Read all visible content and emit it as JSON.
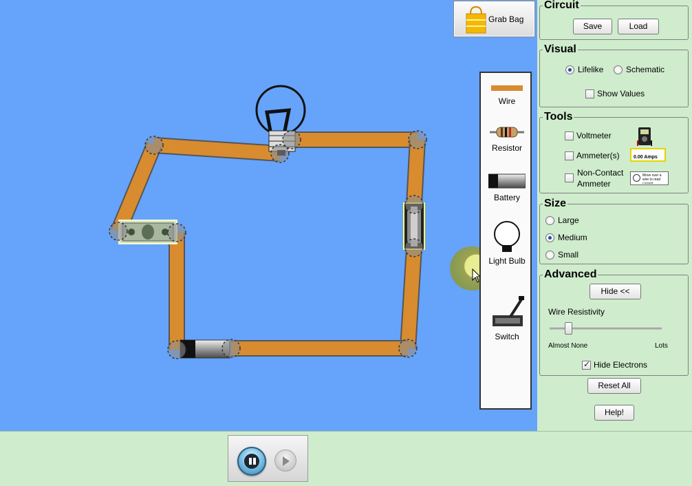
{
  "grab_bag": {
    "label": "Grab Bag"
  },
  "toolbox": {
    "items": [
      {
        "label": "Wire",
        "icon": "wire-icon"
      },
      {
        "label": "Resistor",
        "icon": "resistor-icon"
      },
      {
        "label": "Battery",
        "icon": "battery-icon"
      },
      {
        "label": "Light Bulb",
        "icon": "light-bulb-icon"
      },
      {
        "label": "Switch",
        "icon": "switch-icon"
      }
    ]
  },
  "panel": {
    "circuit": {
      "title": "Circuit",
      "save": "Save",
      "load": "Load"
    },
    "visual": {
      "title": "Visual",
      "lifelike": "Lifelike",
      "schematic": "Schematic",
      "show_values": "Show Values",
      "selected": "Lifelike",
      "show_values_checked": false
    },
    "tools": {
      "title": "Tools",
      "voltmeter": "Voltmeter",
      "ammeters": "Ammeter(s)",
      "ammeter_readout": "0.00 Amps",
      "noncontact_1": "Non-Contact",
      "noncontact_2": "Ammeter",
      "noncontact_hint": "Move over a wire to read current"
    },
    "size": {
      "title": "Size",
      "large": "Large",
      "medium": "Medium",
      "small": "Small",
      "selected": "Medium"
    },
    "advanced": {
      "title": "Advanced",
      "hide": "Hide <<",
      "wire_resistivity": "Wire Resistivity",
      "almost_none": "Almost None",
      "lots": "Lots",
      "wire_resistivity_value": 0.0,
      "hide_electrons": "Hide Electrons",
      "hide_electrons_checked": true
    },
    "reset_all": "Reset All",
    "help": "Help!"
  },
  "colors": {
    "canvas": "#66a3fa",
    "panel_bg": "#cfeccd",
    "wire": "#d88c2f",
    "selection": "#ffff66"
  }
}
